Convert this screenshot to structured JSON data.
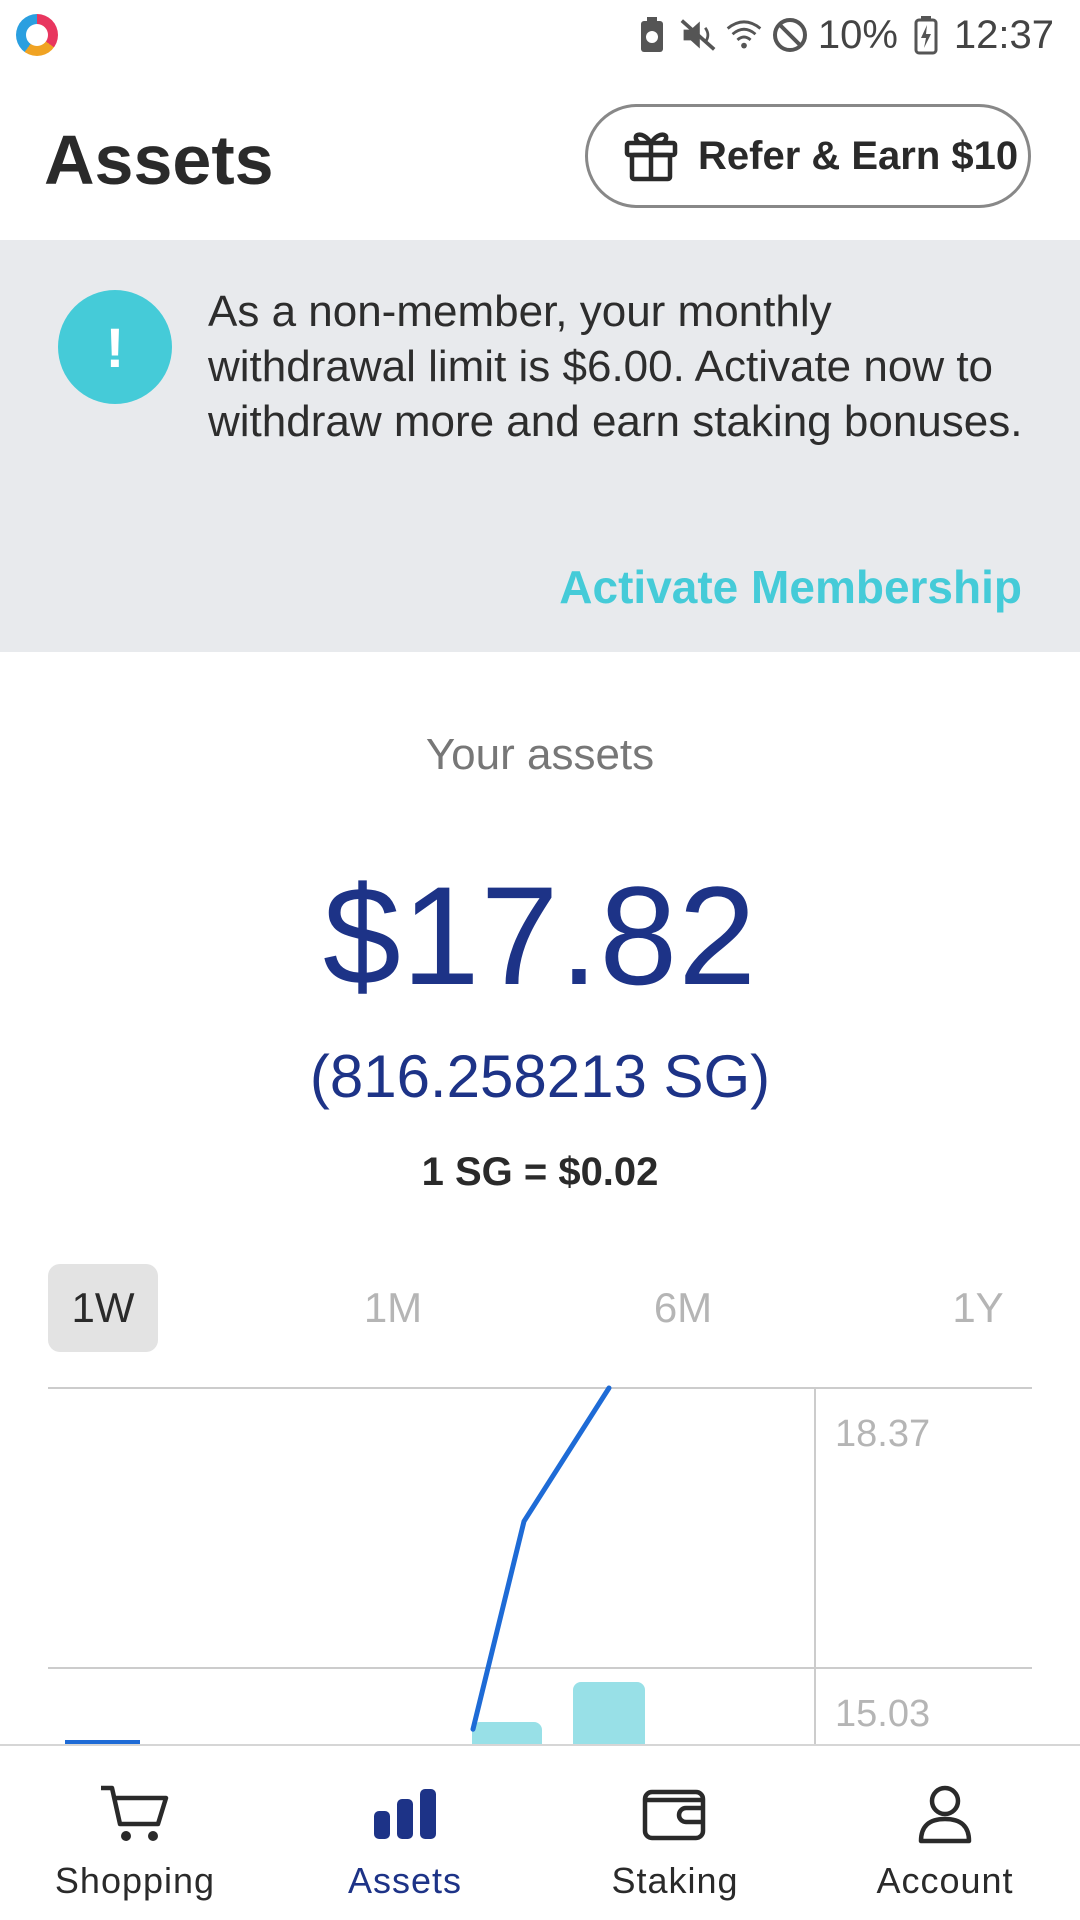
{
  "status_bar": {
    "battery": "10%",
    "time": "12:37"
  },
  "header": {
    "title": "Assets",
    "refer_button": "Refer & Earn $10"
  },
  "banner": {
    "icon_glyph": "!",
    "message": "As a non-member, your monthly withdrawal limit is $6.00. Activate now to withdraw more and earn staking bonuses.",
    "action": "Activate Membership",
    "accent_color": "#45cbd8"
  },
  "summary": {
    "label": "Your assets",
    "usd_value": "$17.82",
    "sg_value": "(816.258213 SG)",
    "rate": "1 SG = $0.02",
    "accent_color": "#1d3387"
  },
  "range_tabs": [
    {
      "label": "1W",
      "active": true
    },
    {
      "label": "1M",
      "active": false
    },
    {
      "label": "6M",
      "active": false
    },
    {
      "label": "1Y",
      "active": false
    }
  ],
  "chart_data": {
    "type": "line",
    "y_tick_labels": [
      "18.37",
      "15.03"
    ],
    "grid": true,
    "line_color": "#1e6bd6",
    "bar_color": "#98e0e7",
    "line_points": [
      {
        "x_index": 5,
        "y": 14.3
      },
      {
        "x_index": 5.6,
        "y": 16.78
      },
      {
        "x_index": 6.6,
        "y": 18.37
      }
    ],
    "bars": [
      {
        "x_index": 5.4,
        "value": 15.03
      },
      {
        "x_index": 6.6,
        "value": 15.03
      }
    ]
  },
  "bottom_nav": [
    {
      "label": "Shopping",
      "icon": "shopping-cart-icon",
      "active": false
    },
    {
      "label": "Assets",
      "icon": "bar-chart-icon",
      "active": true
    },
    {
      "label": "Staking",
      "icon": "wallet-icon",
      "active": false
    },
    {
      "label": "Account",
      "icon": "person-icon",
      "active": false
    }
  ]
}
